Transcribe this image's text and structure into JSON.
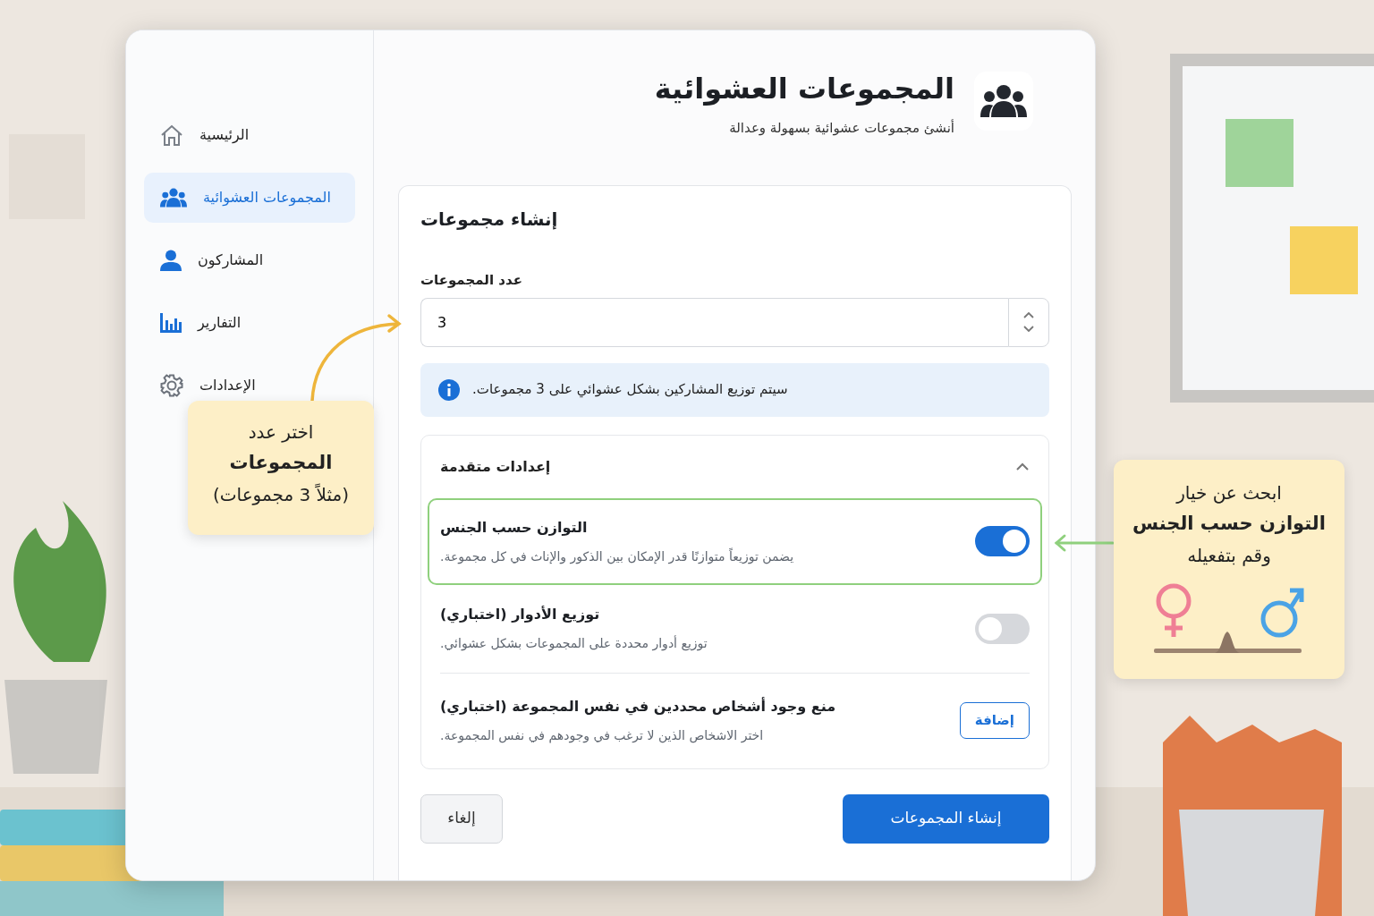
{
  "sidebar": {
    "items": [
      {
        "label": "الرئيسية",
        "selected": false
      },
      {
        "label": "المجموعات العشوائية",
        "selected": true
      },
      {
        "label": "المشاركون",
        "selected": false
      },
      {
        "label": "التفارير",
        "selected": false
      },
      {
        "label": "الإعدادات",
        "selected": false
      }
    ]
  },
  "header": {
    "title": "المجموعات العشوائية",
    "subtitle": "أنشئ مجموعات عشوائية بسهولة وعدالة"
  },
  "form": {
    "title": "إنشاء مجموعات",
    "count_label": "عدد المجموعات",
    "count_value": "3",
    "info": "سيتم توزيع المشاركين بشكل عشوائي على 3 مجموعات.",
    "advanced": {
      "title": "إعدادات متقدمة",
      "expanded": true,
      "options": [
        {
          "kind": "toggle",
          "title": "التوازن حسب الجنس",
          "description": "يضمن توزيعاً متوازنًا قدر الإمكان بين الذكور والإناث في كل مجموعة.",
          "on": true,
          "highlighted": true
        },
        {
          "kind": "toggle",
          "title": "توزيع الأدوار (اختباري)",
          "description": "توزيع أدوار محددة على المجموعات بشكل عشوائي.",
          "on": false,
          "highlighted": false
        },
        {
          "kind": "action",
          "title": "منع وجود أشخاص محددين في نفس المجموعة (اختباري)",
          "description": "اختر الاشخاص الذين لا ترغب في وجودهم في نفس المجموعة.",
          "button": "إضافة",
          "highlighted": false
        }
      ]
    },
    "buttons": {
      "cancel": "إلغاء",
      "create": "إنشاء المجموعات"
    }
  },
  "callouts": [
    {
      "lines": [
        {
          "text": "اختر عدد",
          "bold": false
        },
        {
          "text": "المجموعات",
          "bold": true
        },
        {
          "text": "(مثلاً 3 مجموعات)",
          "bold": false
        }
      ]
    },
    {
      "lines": [
        {
          "text": "ابحث عن خيار",
          "bold": false
        },
        {
          "text": "التوازن حسب الجنس",
          "bold": true
        },
        {
          "text": "وقم بتفعيله",
          "bold": false
        }
      ]
    }
  ]
}
